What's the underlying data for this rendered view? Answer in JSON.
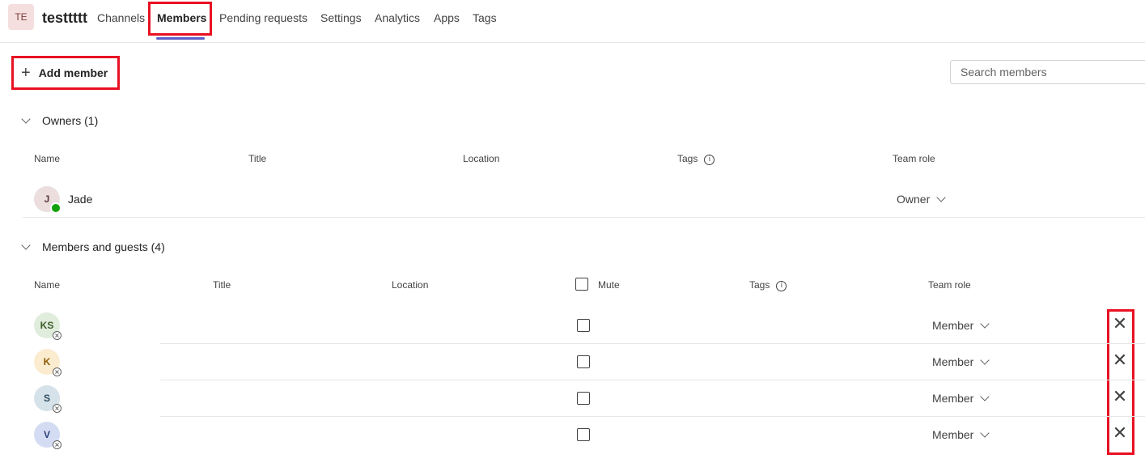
{
  "team": {
    "initials": "TE",
    "name": "testtttt"
  },
  "tabs": [
    "Channels",
    "Members",
    "Pending requests",
    "Settings",
    "Analytics",
    "Apps",
    "Tags"
  ],
  "actions": {
    "add_member": "Add member"
  },
  "search": {
    "placeholder": "Search members"
  },
  "owners": {
    "title": "Owners (1)",
    "columns": {
      "name": "Name",
      "title": "Title",
      "location": "Location",
      "tags": "Tags",
      "role": "Team role"
    },
    "rows": [
      {
        "initials": "J",
        "name": "Jade",
        "role": "Owner",
        "status": "available"
      }
    ]
  },
  "members": {
    "title": "Members and guests (4)",
    "columns": {
      "name": "Name",
      "title": "Title",
      "location": "Location",
      "mute": "Mute",
      "tags": "Tags",
      "role": "Team role"
    },
    "rows": [
      {
        "initials": "KS",
        "role": "Member",
        "status": "offline",
        "avatar_bg": "#e0ecdc",
        "avatar_fg": "#3b5e2b"
      },
      {
        "initials": "K",
        "role": "Member",
        "status": "offline",
        "avatar_bg": "#fbecd0",
        "avatar_fg": "#8a5a00"
      },
      {
        "initials": "S",
        "role": "Member",
        "status": "offline",
        "avatar_bg": "#d6e2ea",
        "avatar_fg": "#2e4b5e"
      },
      {
        "initials": "V",
        "role": "Member",
        "status": "offline",
        "avatar_bg": "#d3dcf2",
        "avatar_fg": "#2b3f7a"
      }
    ]
  },
  "colors": {
    "accent": "#5b5fc7",
    "highlight": "#e81123",
    "available": "#13a10e"
  }
}
